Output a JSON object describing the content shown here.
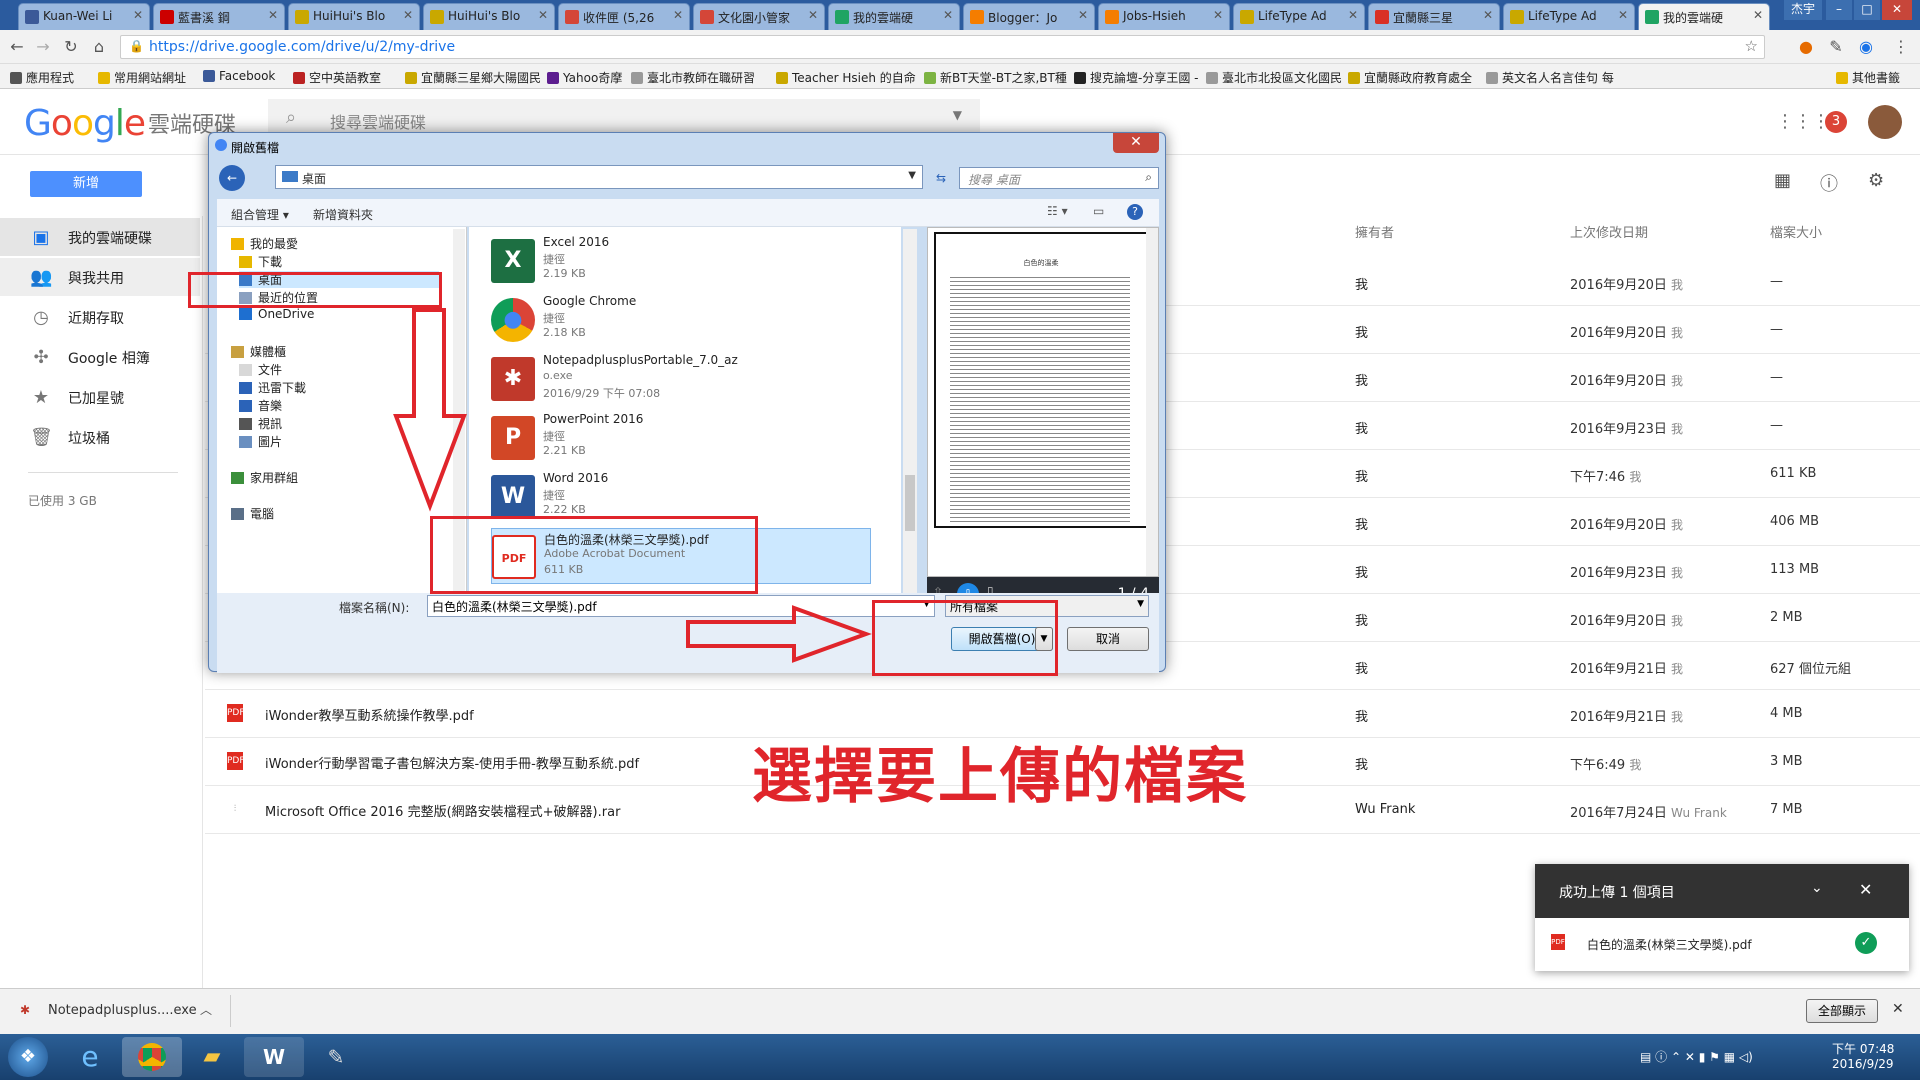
{
  "browser": {
    "tabs": [
      {
        "label": "Kuan-Wei Li",
        "color": "#3b5998"
      },
      {
        "label": "藍書溪 鋼",
        "color": "#cc0000"
      },
      {
        "label": "HuiHui's Blo",
        "color": "#c9a800"
      },
      {
        "label": "HuiHui's Blo",
        "color": "#c9a800"
      },
      {
        "label": "收件匣 (5,26",
        "color": "#d44638"
      },
      {
        "label": "文化園小管家",
        "color": "#d44638"
      },
      {
        "label": "我的雲端硬",
        "color": "#1fa463"
      },
      {
        "label": "Blogger：Jo",
        "color": "#f57d00"
      },
      {
        "label": "Jobs-Hsieh",
        "color": "#f57d00"
      },
      {
        "label": "LifeType Ad",
        "color": "#c9a800"
      },
      {
        "label": "宜蘭縣三星",
        "color": "#d93025"
      },
      {
        "label": "LifeType Ad",
        "color": "#c9a800"
      },
      {
        "label": "我的雲端硬",
        "color": "#1fa463"
      }
    ],
    "user_label": "杰宇",
    "url": "https://drive.google.com/drive/u/2/my-drive",
    "bookmarks": [
      "應用程式",
      "常用網站網址",
      "Facebook",
      "空中英語教室",
      "宜蘭縣三星鄉大陽國民",
      "Yahoo奇摩",
      "臺北市教師在職研習",
      "Teacher Hsieh 的自命",
      "新BT天堂-BT之家,BT種",
      "搜克論壇-分享王國 -",
      "臺北市北投區文化國民",
      "宜蘭縣政府教育處全",
      "英文名人名言佳句 每"
    ],
    "bookmarks_more": "其他書籤"
  },
  "drive": {
    "logo": "Google",
    "product": "雲端硬碟",
    "search_placeholder": "搜尋雲端硬碟",
    "notif_count": "3",
    "new_button": "新增",
    "sidebar": [
      {
        "label": "我的雲端硬碟"
      },
      {
        "label": "與我共用"
      },
      {
        "label": "近期存取"
      },
      {
        "label": "Google 相簿"
      },
      {
        "label": "已加星號"
      },
      {
        "label": "垃圾桶"
      }
    ],
    "storage": "已使用 3 GB",
    "columns": {
      "owner": "擁有者",
      "modified": "上次修改日期",
      "size": "檔案大小"
    },
    "rows": [
      {
        "name": "",
        "owner": "我",
        "date": "2016年9月20日",
        "by": "我",
        "size": "—"
      },
      {
        "name": "",
        "owner": "我",
        "date": "2016年9月20日",
        "by": "我",
        "size": "—"
      },
      {
        "name": "",
        "owner": "我",
        "date": "2016年9月20日",
        "by": "我",
        "size": "—"
      },
      {
        "name": "",
        "owner": "我",
        "date": "2016年9月23日",
        "by": "我",
        "size": "—"
      },
      {
        "name": "",
        "owner": "我",
        "date": "下午7:46",
        "by": "我",
        "size": "611 KB"
      },
      {
        "name": "",
        "owner": "我",
        "date": "2016年9月20日",
        "by": "我",
        "size": "406 MB"
      },
      {
        "name": "",
        "owner": "我",
        "date": "2016年9月23日",
        "by": "我",
        "size": "113 MB"
      },
      {
        "name": "",
        "owner": "我",
        "date": "2016年9月20日",
        "by": "我",
        "size": "2 MB"
      },
      {
        "name": "",
        "owner": "我",
        "date": "2016年9月21日",
        "by": "我",
        "size": "627 個位元組"
      },
      {
        "name": "iWonder教學互動系統操作教學.pdf",
        "owner": "我",
        "date": "2016年9月21日",
        "by": "我",
        "size": "4 MB"
      },
      {
        "name": "iWonder行動學習電子書包解決方案-使用手冊-教學互動系統.pdf",
        "owner": "我",
        "date": "下午6:49",
        "by": "我",
        "size": "3 MB"
      },
      {
        "name": "Microsoft Office 2016 完整版(網路安裝檔程式+破解器).rar",
        "owner": "Wu Frank",
        "date": "2016年7月24日",
        "by": "Wu Frank",
        "size": "7 MB"
      }
    ]
  },
  "dialog": {
    "title": "開啟舊檔",
    "location": "桌面",
    "search_placeholder": "搜尋 桌面",
    "organize": "組合管理",
    "new_folder": "新增資料夾",
    "tree": [
      {
        "label": "我的最愛",
        "indent": 0
      },
      {
        "label": "下載",
        "indent": 1
      },
      {
        "label": "桌面",
        "indent": 1
      },
      {
        "label": "最近的位置",
        "indent": 1
      },
      {
        "label": "OneDrive",
        "indent": 1
      },
      {
        "label": "媒體櫃",
        "indent": 0
      },
      {
        "label": "文件",
        "indent": 1
      },
      {
        "label": "迅雷下載",
        "indent": 1
      },
      {
        "label": "音樂",
        "indent": 1
      },
      {
        "label": "視訊",
        "indent": 1
      },
      {
        "label": "圖片",
        "indent": 1
      },
      {
        "label": "家用群組",
        "indent": 0
      },
      {
        "label": "電腦",
        "indent": 0
      }
    ],
    "files": [
      {
        "name": "Excel 2016",
        "type": "捷徑",
        "size": "2.19 KB",
        "icon": "X",
        "color": "#1d6f42"
      },
      {
        "name": "Google Chrome",
        "type": "捷徑",
        "size": "2.18 KB",
        "icon": "●",
        "color": "#db4437"
      },
      {
        "name": "NotepadplusplusPortable_7.0_az",
        "type": "o.exe",
        "size": "2016/9/29 下午 07:08",
        "icon": "✱",
        "color": "#c0392b"
      },
      {
        "name": "PowerPoint 2016",
        "type": "捷徑",
        "size": "2.21 KB",
        "icon": "P",
        "color": "#d24726"
      },
      {
        "name": "Word 2016",
        "type": "捷徑",
        "size": "2.22 KB",
        "icon": "W",
        "color": "#2b579a"
      },
      {
        "name": "白色的溫柔(林榮三文學獎).pdf",
        "type": "Adobe Acrobat Document",
        "size": "611 KB",
        "icon": "PDF",
        "color": "#e02b20"
      }
    ],
    "preview_title": "白色的溫柔",
    "preview_page": "1 / 4",
    "filename_label": "檔案名稱(N):",
    "filename": "白色的溫柔(林榮三文學獎).pdf",
    "filetype": "所有檔案",
    "open_button": "開啟舊檔(O)",
    "cancel_button": "取消"
  },
  "annotation": "選擇要上傳的檔案",
  "toast": {
    "title": "成功上傳 1 個項目",
    "file": "白色的溫柔(林榮三文學獎).pdf"
  },
  "shelf": {
    "download": "Notepadplusplus....exe",
    "show_all": "全部顯示"
  },
  "taskbar": {
    "time": "下午 07:48",
    "date": "2016/9/29"
  }
}
